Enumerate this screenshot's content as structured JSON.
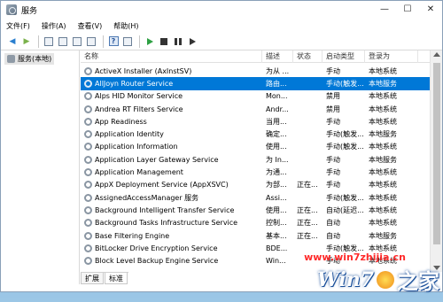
{
  "window": {
    "title": "服务"
  },
  "controls": {
    "minimize": "—",
    "maximize": "☐",
    "close": "✕"
  },
  "menu": [
    "文件(F)",
    "操作(A)",
    "查看(V)",
    "帮助(H)"
  ],
  "tree": {
    "root_label": "服务(本地)"
  },
  "columns": {
    "name": "名称",
    "desc": "描述",
    "status": "状态",
    "startup": "启动类型",
    "logon": "登录为"
  },
  "rows": [
    {
      "name": "ActiveX Installer (AxInstSV)",
      "desc": "为从 ...",
      "status": "",
      "startup": "手动",
      "logon": "本地系统"
    },
    {
      "name": "AllJoyn Router Service",
      "desc": "路由...",
      "status": "",
      "startup": "手动(触发...",
      "logon": "本地服务"
    },
    {
      "name": "Alps HID Monitor Service",
      "desc": "Mon...",
      "status": "",
      "startup": "禁用",
      "logon": "本地系统"
    },
    {
      "name": "Andrea RT Filters Service",
      "desc": "Andr...",
      "status": "",
      "startup": "禁用",
      "logon": "本地系统"
    },
    {
      "name": "App Readiness",
      "desc": "当用...",
      "status": "",
      "startup": "手动",
      "logon": "本地系统"
    },
    {
      "name": "Application Identity",
      "desc": "确定...",
      "status": "",
      "startup": "手动(触发...",
      "logon": "本地服务"
    },
    {
      "name": "Application Information",
      "desc": "使用...",
      "status": "",
      "startup": "手动(触发...",
      "logon": "本地系统"
    },
    {
      "name": "Application Layer Gateway Service",
      "desc": "为 In...",
      "status": "",
      "startup": "手动",
      "logon": "本地服务"
    },
    {
      "name": "Application Management",
      "desc": "为通...",
      "status": "",
      "startup": "手动",
      "logon": "本地系统"
    },
    {
      "name": "AppX Deployment Service (AppXSVC)",
      "desc": "为部...",
      "status": "正在...",
      "startup": "手动",
      "logon": "本地系统"
    },
    {
      "name": "AssignedAccessManager 服务",
      "desc": "Assi...",
      "status": "",
      "startup": "手动(触发...",
      "logon": "本地系统"
    },
    {
      "name": "Background Intelligent Transfer Service",
      "desc": "使用...",
      "status": "正在...",
      "startup": "自动(延迟...",
      "logon": "本地系统"
    },
    {
      "name": "Background Tasks Infrastructure Service",
      "desc": "控制...",
      "status": "正在...",
      "startup": "自动",
      "logon": "本地系统"
    },
    {
      "name": "Base Filtering Engine",
      "desc": "基本...",
      "status": "正在...",
      "startup": "自动",
      "logon": "本地服务"
    },
    {
      "name": "BitLocker Drive Encryption Service",
      "desc": "BDE...",
      "status": "",
      "startup": "手动(触发...",
      "logon": "本地系统"
    },
    {
      "name": "Block Level Backup Engine Service",
      "desc": "Win...",
      "status": "",
      "startup": "手动",
      "logon": "本地系统"
    }
  ],
  "selected_row_index": 1,
  "tabs": [
    "扩展",
    "标准"
  ],
  "active_tab_index": 1,
  "watermark": {
    "url": "www.win7zhijia.cn",
    "brand": "Win7",
    "suffix": "之家"
  },
  "colors": {
    "selection": "#0078d7",
    "watermark_url": "#ff2a2a"
  },
  "icons": {
    "back": "back-arrow-icon",
    "forward": "forward-arrow-icon",
    "start": "play-icon",
    "stop": "stop-icon",
    "pause": "pause-icon",
    "restart": "restart-icon",
    "service": "gear-icon"
  }
}
